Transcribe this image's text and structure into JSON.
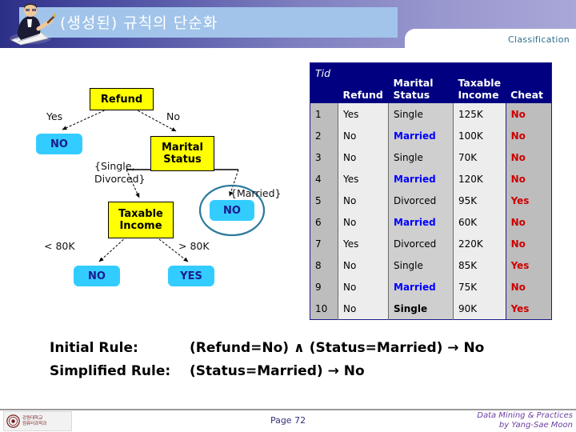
{
  "header": {
    "title": "(생성된) 규칙의 단순화",
    "section_label": "Classification",
    "icon": "writer-person-icon",
    "plate_color": "#a2c4ea",
    "gradient_from": "#2c2f86",
    "gradient_to": "#a9a7d8"
  },
  "tree": {
    "nodes": {
      "refund": "Refund",
      "marital_status": "Marital\nStatus",
      "taxable_income": "Taxable\nIncome",
      "leaf_refund_yes": "NO",
      "leaf_married": "NO",
      "leaf_income_low": "NO",
      "leaf_income_high": "YES"
    },
    "edge_labels": {
      "yes": "Yes",
      "no": "No",
      "single_divorced": "{Single,\nDivorced}",
      "married": "{Married}",
      "lt_80k": "< 80K",
      "gt_80k": "> 80K"
    },
    "colors": {
      "internal_node": "#ffff00",
      "leaf_node": "#33ccff",
      "leaf_text": "#1a1a8c",
      "highlight_ellipse": "#2e7a9e"
    }
  },
  "table": {
    "columns": [
      "Tid",
      "Refund",
      "Marital\nStatus",
      "Taxable\nIncome",
      "Cheat"
    ],
    "header_tid": "Tid",
    "header_refund": "Refund",
    "header_marital": "Marital Status",
    "header_income": "Taxable Income",
    "header_cheat": "Cheat",
    "rows": [
      {
        "tid": "1",
        "refund": "Yes",
        "status": "Single",
        "status_style": "plain",
        "income": "125K",
        "cheat": "No"
      },
      {
        "tid": "2",
        "refund": "No",
        "status": "Married",
        "status_style": "married",
        "income": "100K",
        "cheat": "No"
      },
      {
        "tid": "3",
        "refund": "No",
        "status": "Single",
        "status_style": "plain",
        "income": "70K",
        "cheat": "No"
      },
      {
        "tid": "4",
        "refund": "Yes",
        "status": "Married",
        "status_style": "married",
        "income": "120K",
        "cheat": "No"
      },
      {
        "tid": "5",
        "refund": "No",
        "status": "Divorced",
        "status_style": "plain",
        "income": "95K",
        "cheat": "Yes"
      },
      {
        "tid": "6",
        "refund": "No",
        "status": "Married",
        "status_style": "married",
        "income": "60K",
        "cheat": "No"
      },
      {
        "tid": "7",
        "refund": "Yes",
        "status": "Divorced",
        "status_style": "plain",
        "income": "220K",
        "cheat": "No"
      },
      {
        "tid": "8",
        "refund": "No",
        "status": "Single",
        "status_style": "plain",
        "income": "85K",
        "cheat": "Yes"
      },
      {
        "tid": "9",
        "refund": "No",
        "status": "Married",
        "status_style": "married",
        "income": "75K",
        "cheat": "No"
      },
      {
        "tid": "10",
        "refund": "No",
        "status": "Single",
        "status_style": "bold",
        "income": "90K",
        "cheat": "Yes"
      }
    ],
    "colors": {
      "header_bg": "#000080",
      "married_text": "#0000ff",
      "cheat_text": "#cc0000"
    }
  },
  "rules": {
    "initial_label": "Initial Rule:",
    "initial_expr": "(Refund=No) ∧ (Status=Married) → No",
    "simplified_label": "Simplified Rule:",
    "simplified_expr": "(Status=Married) → No"
  },
  "footer": {
    "logo_text": "강원대학교\n컴퓨터과학과",
    "page": "Page 72",
    "credit_line1": "Data Mining & Practices",
    "credit_line2": "by Yang-Sae Moon"
  }
}
